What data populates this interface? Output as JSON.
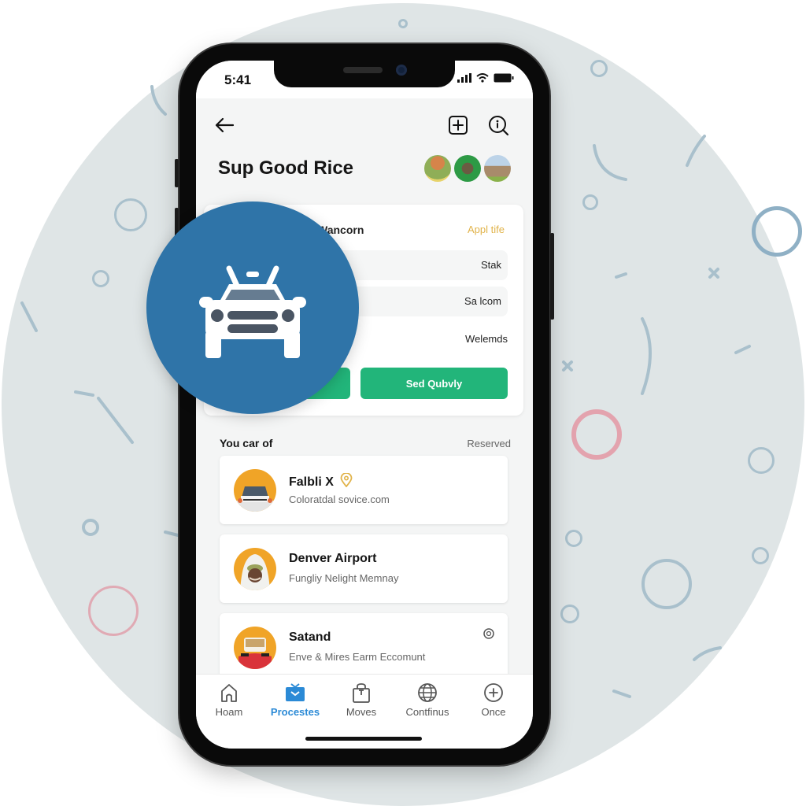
{
  "status_bar": {
    "time": "5:41"
  },
  "header": {
    "back_icon": "arrow-left-icon",
    "add_icon": "plus-square-icon",
    "search_icon": "search-info-icon",
    "title": "Sup Good Rice",
    "avatars": [
      "landscape-avatar-1",
      "person-avatar-2",
      "building-avatar-3"
    ]
  },
  "booking_card": {
    "heading": "Wancorn",
    "link": "Appl tife",
    "rows": [
      "Stak",
      "Sa lcom",
      "Welemds"
    ],
    "primary_button": "Sed Qubvly",
    "secondary_button": ""
  },
  "overlay_badge": {
    "icon": "taxi-car-icon",
    "color": "#2f74a8"
  },
  "section": {
    "title": "You car of",
    "link": "Reserved"
  },
  "list": [
    {
      "title": "Falbli X",
      "subtitle": "Coloratdal sovice.com",
      "badge_icon": "location-pin-icon"
    },
    {
      "title": "Denver Airport",
      "subtitle": "Fungliy Nelight Memnay",
      "badge_icon": ""
    },
    {
      "title": "Satand",
      "subtitle": "Enve & Mires Earm Eccomunt",
      "badge_icon": "info-circle-icon"
    }
  ],
  "tabs": [
    {
      "label": "Hoam",
      "icon": "home-icon",
      "active": false
    },
    {
      "label": "Procestes",
      "icon": "inbox-icon",
      "active": true
    },
    {
      "label": "Moves",
      "icon": "bag-icon",
      "active": false
    },
    {
      "label": "Contfinus",
      "icon": "globe-icon",
      "active": false
    },
    {
      "label": "Once",
      "icon": "plus-circle-icon",
      "active": false
    }
  ],
  "colors": {
    "accent_green": "#22b57a",
    "accent_blue": "#2b8ad6",
    "link_yellow": "#e1b34a",
    "avatar_orange": "#f0a427"
  }
}
